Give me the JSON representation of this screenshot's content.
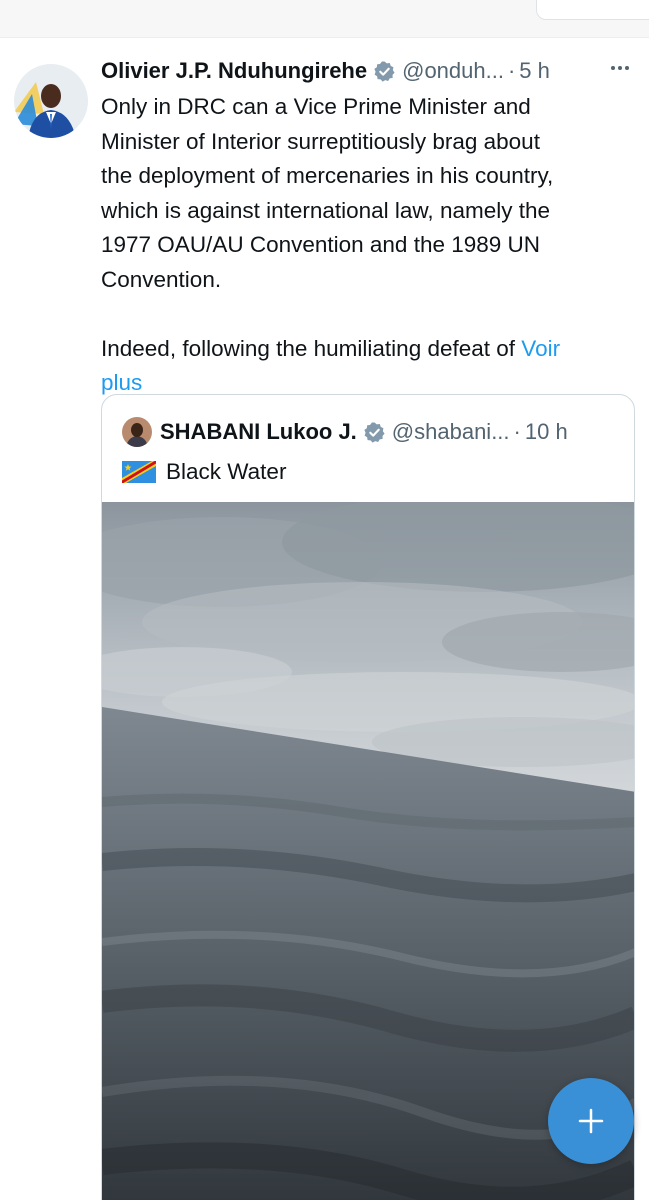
{
  "tweet": {
    "author_name": "Olivier J.P. Nduhungirehe",
    "handle": "@onduh...",
    "separator": "·",
    "time": "5 h",
    "text_lines": [
      "Only in DRC can a Vice Prime Minister and",
      "Minister of Interior surreptitiously brag about",
      "the deployment of mercenaries in his country,",
      "which is against international law, namely the",
      "1977 OAU/AU Convention and the 1989 UN",
      "Convention."
    ],
    "text_line_7": "Indeed, following the humiliating defeat of ",
    "show_more_part1": "Voir",
    "show_more_part2": "plus",
    "icons": {
      "avatar": "avatar-image",
      "verified": "verified-badge-icon",
      "more": "more-options-icon"
    }
  },
  "quoted_tweet": {
    "author_name": "SHABANI Lukoo J.",
    "handle": "@shabani...",
    "separator": "·",
    "time": "10 h",
    "flag_icon": "drc-flag-emoji",
    "text": "Black Water",
    "media": "lake-water-photo"
  },
  "fab": {
    "icon": "plus-icon"
  },
  "colors": {
    "text": "#0f1419",
    "secondary": "#536471",
    "link": "#1d9bf0",
    "border": "#cfd9de",
    "fab": "#3a90d6",
    "verified": "#829aab"
  }
}
